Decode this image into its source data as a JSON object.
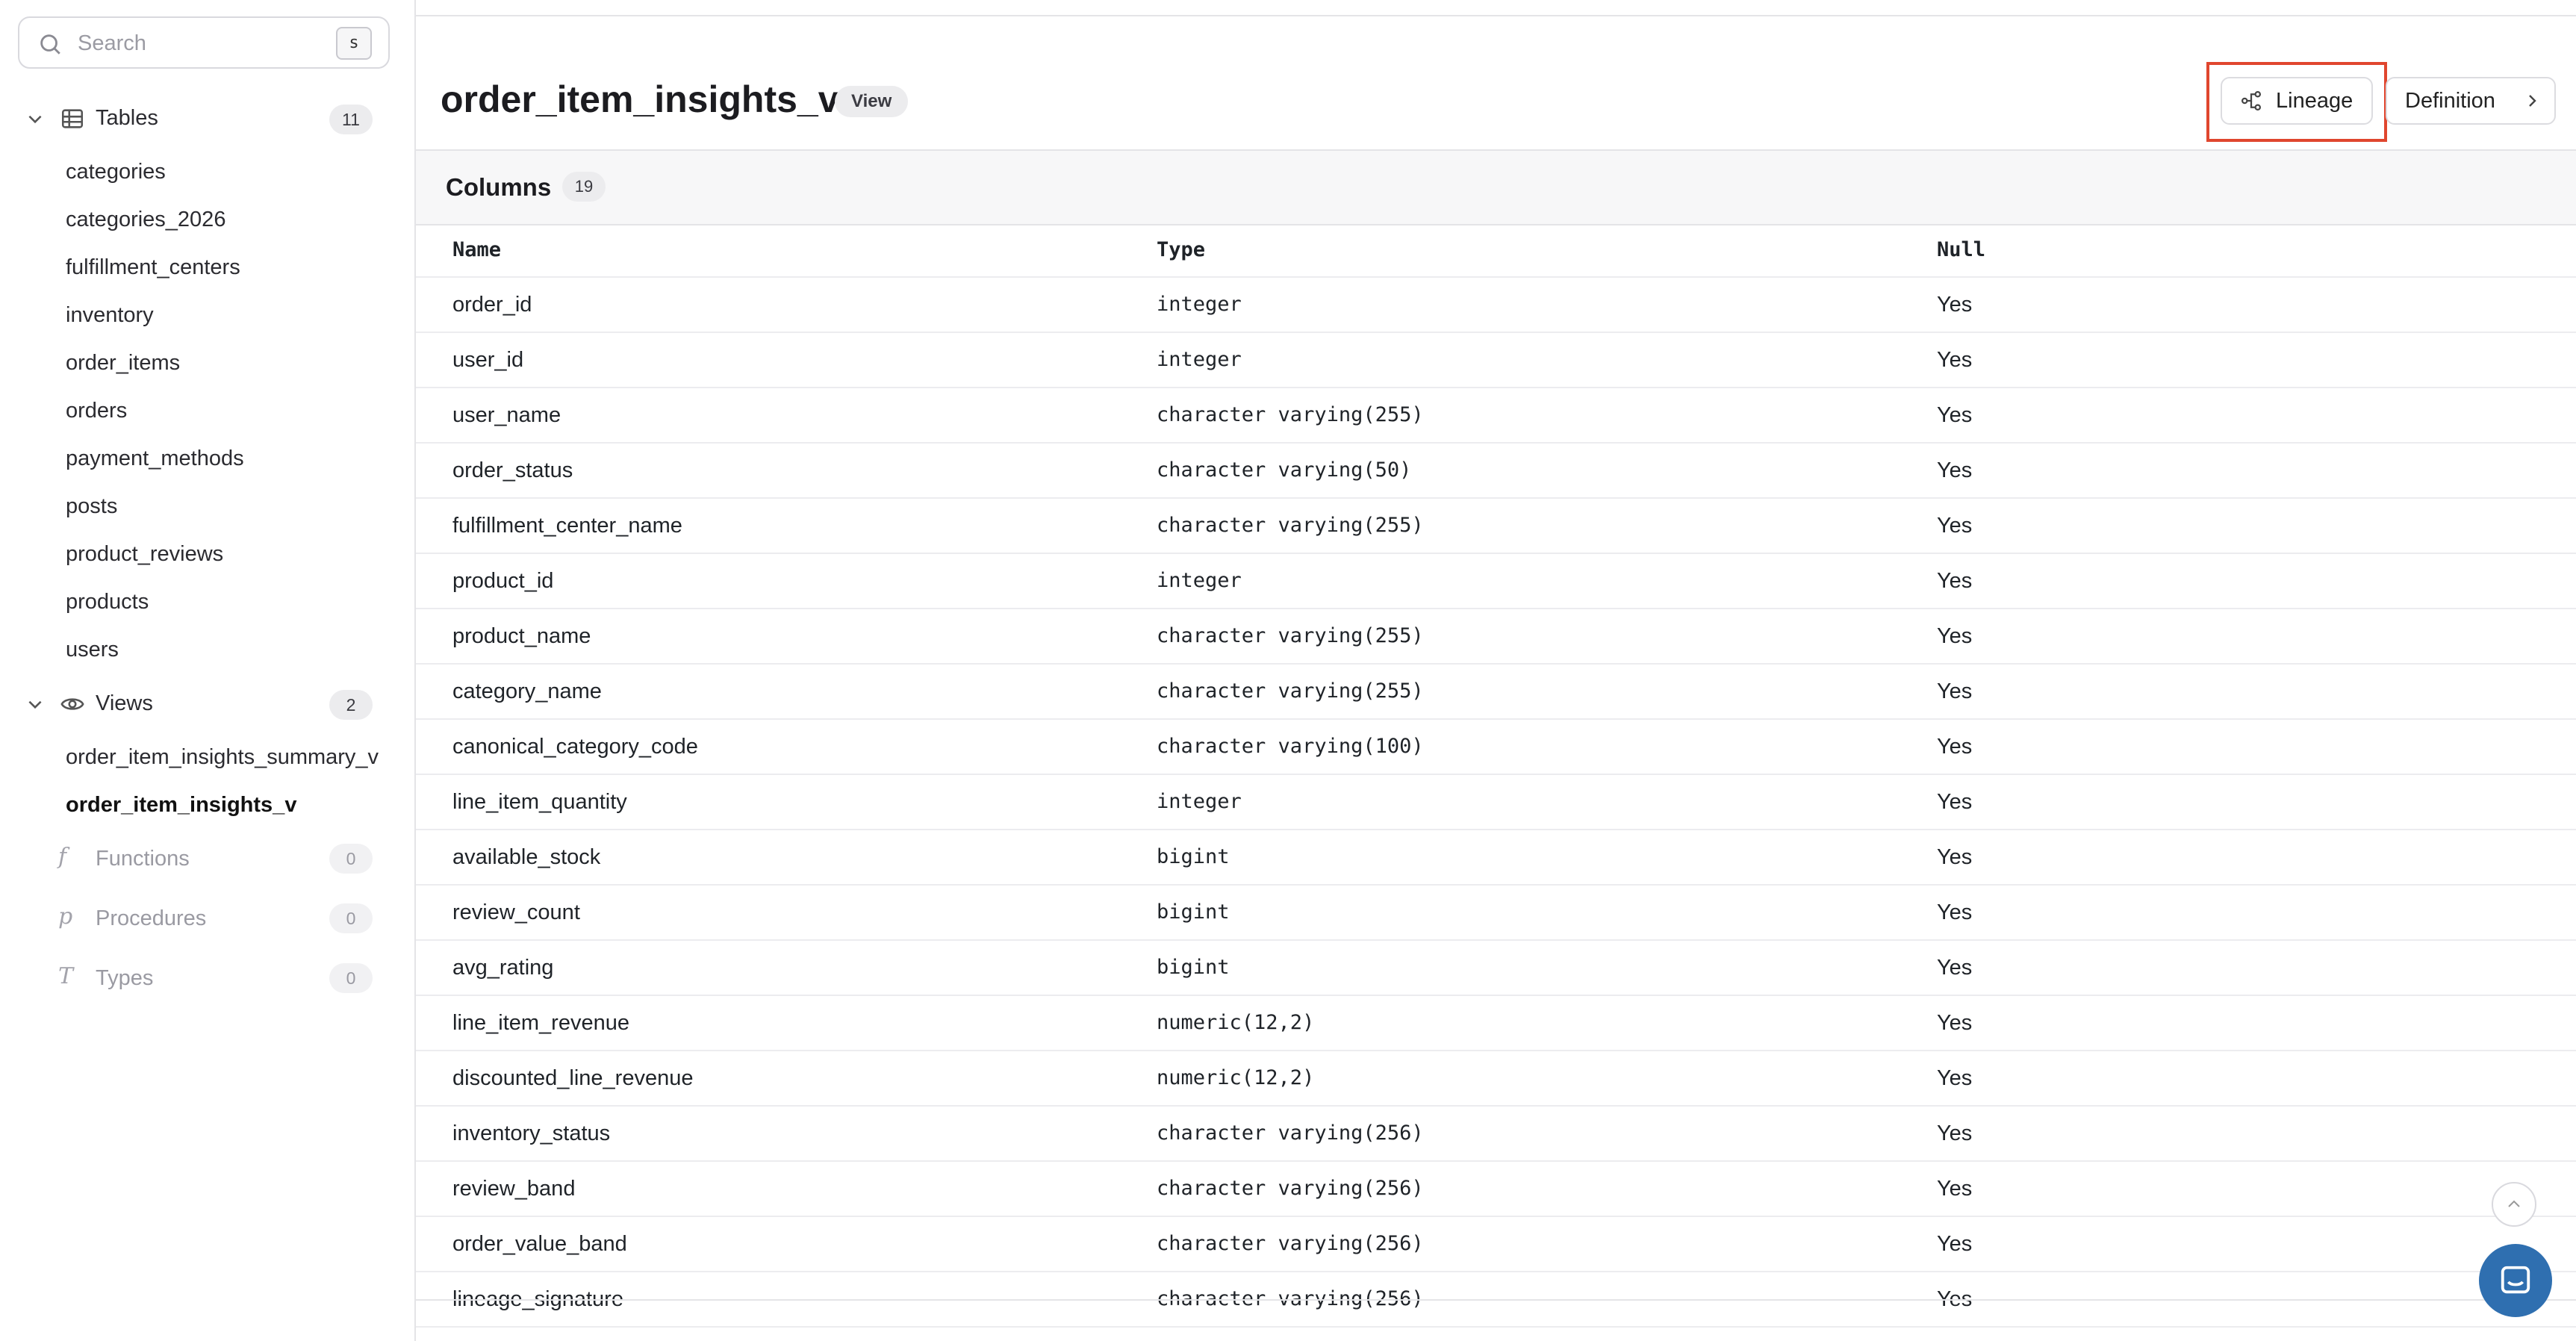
{
  "search": {
    "placeholder": "Search",
    "shortcut": "s"
  },
  "tables": {
    "label": "Tables",
    "count": "11",
    "items": [
      "categories",
      "categories_2026",
      "fulfillment_centers",
      "inventory",
      "order_items",
      "orders",
      "payment_methods",
      "posts",
      "product_reviews",
      "products",
      "users"
    ]
  },
  "views": {
    "label": "Views",
    "count": "2",
    "items": [
      "order_item_insights_summary_v",
      "order_item_insights_v"
    ]
  },
  "functions": {
    "glyph": "f",
    "label": "Functions",
    "count": "0"
  },
  "procedures": {
    "glyph": "p",
    "label": "Procedures",
    "count": "0"
  },
  "types": {
    "glyph": "T",
    "label": "Types",
    "count": "0"
  },
  "page": {
    "title": "order_item_insights_v",
    "badge": "View",
    "lineage_label": "Lineage",
    "definition_label": "Definition"
  },
  "columns": {
    "label": "Columns",
    "count": "19",
    "headers": {
      "name": "Name",
      "type": "Type",
      "null": "Null"
    },
    "rows": [
      {
        "name": "order_id",
        "type": "integer",
        "null": "Yes"
      },
      {
        "name": "user_id",
        "type": "integer",
        "null": "Yes"
      },
      {
        "name": "user_name",
        "type": "character varying(255)",
        "null": "Yes"
      },
      {
        "name": "order_status",
        "type": "character varying(50)",
        "null": "Yes"
      },
      {
        "name": "fulfillment_center_name",
        "type": "character varying(255)",
        "null": "Yes"
      },
      {
        "name": "product_id",
        "type": "integer",
        "null": "Yes"
      },
      {
        "name": "product_name",
        "type": "character varying(255)",
        "null": "Yes"
      },
      {
        "name": "category_name",
        "type": "character varying(255)",
        "null": "Yes"
      },
      {
        "name": "canonical_category_code",
        "type": "character varying(100)",
        "null": "Yes"
      },
      {
        "name": "line_item_quantity",
        "type": "integer",
        "null": "Yes"
      },
      {
        "name": "available_stock",
        "type": "bigint",
        "null": "Yes"
      },
      {
        "name": "review_count",
        "type": "bigint",
        "null": "Yes"
      },
      {
        "name": "avg_rating",
        "type": "bigint",
        "null": "Yes"
      },
      {
        "name": "line_item_revenue",
        "type": "numeric(12,2)",
        "null": "Yes"
      },
      {
        "name": "discounted_line_revenue",
        "type": "numeric(12,2)",
        "null": "Yes"
      },
      {
        "name": "inventory_status",
        "type": "character varying(256)",
        "null": "Yes"
      },
      {
        "name": "review_band",
        "type": "character varying(256)",
        "null": "Yes"
      },
      {
        "name": "order_value_band",
        "type": "character varying(256)",
        "null": "Yes"
      },
      {
        "name": "lineage_signature",
        "type": "character varying(256)",
        "null": "Yes"
      }
    ]
  },
  "colors": {
    "highlight": "#e0462e",
    "chat_button": "#2f6fb0"
  }
}
